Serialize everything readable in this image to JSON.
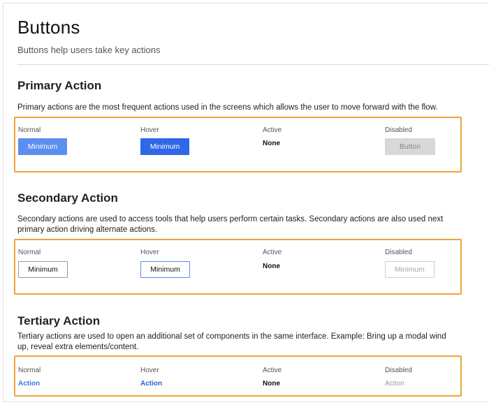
{
  "page": {
    "title": "Buttons",
    "subtitle": "Buttons help users take key actions"
  },
  "sections": {
    "primary": {
      "title": "Primary Action",
      "description": "Primary actions are the most frequent actions used in the screens which allows the user to move forward with the flow.",
      "states": {
        "normal_label": "Normal",
        "hover_label": "Hover",
        "active_label": "Active",
        "disabled_label": "Disabled",
        "normal_value": "Minimum",
        "hover_value": "Minimum",
        "active_value": "None",
        "disabled_value": "Button"
      }
    },
    "secondary": {
      "title": "Secondary Action",
      "description": "Secondary actions are used to access tools that help users perform certain tasks. Secondary actions are also used next\nprimary action driving alternate actions.",
      "states": {
        "normal_label": "Normal",
        "hover_label": "Hover",
        "active_label": "Active",
        "disabled_label": "Disabled",
        "normal_value": "Minimum",
        "hover_value": "Minimum",
        "active_value": "None",
        "disabled_value": "Minimum"
      }
    },
    "tertiary": {
      "title": "Tertiary Action",
      "description": "Tertiary actions are used to open an additional set of components in the same interface. Example: Bring up a modal wind\nup, reveal extra elements/content.",
      "states": {
        "normal_label": "Normal",
        "hover_label": "Hover",
        "active_label": "Active",
        "disabled_label": "Disabled",
        "normal_value": "Action",
        "hover_value": "Action",
        "active_value": "None",
        "disabled_value": "Action"
      }
    }
  },
  "colors": {
    "primary_button": "#5b8ef0",
    "primary_button_hover": "#2f67e8",
    "disabled_fill": "#d8d8d8",
    "highlight_border": "#f0a23a",
    "link": "#3d78e6"
  }
}
